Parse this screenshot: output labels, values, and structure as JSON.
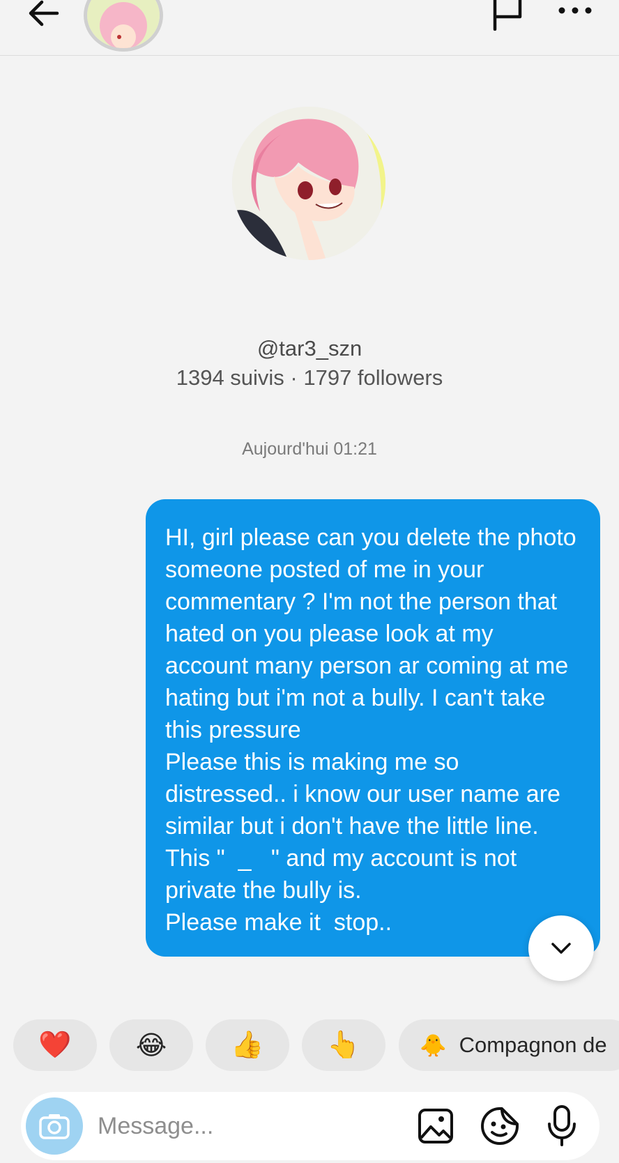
{
  "header": {
    "icons": [
      "back-arrow-icon",
      "flag-icon",
      "more-dots-icon"
    ]
  },
  "profile": {
    "username": "@tar3_szn",
    "stats": "1394 suivis · 1797 followers"
  },
  "conversation": {
    "timestamp": "Aujourd'hui 01:21",
    "message_text": "HI, girl please can you delete the photo someone posted of me in your commentary ? I'm not the person that hated on you please look at my account many person ar coming at me hating but i'm not a bully. I can't take this pressure\nPlease this is making me so distressed.. i know our user name are similar but i don't have the little line. This \"  _   \" and my account is not private the bully is.\nPlease make it  stop..",
    "bubble_color": "#0f96e8"
  },
  "reactions": [
    {
      "emoji": "❤️",
      "name": "heart"
    },
    {
      "emoji": "😂",
      "name": "tears-of-joy"
    },
    {
      "emoji": "👍",
      "name": "thumbs-up"
    },
    {
      "emoji": "👆",
      "name": "pointing-up"
    }
  ],
  "suggestion_chip": {
    "emoji": "🐥",
    "label": "Compagnon de"
  },
  "composer": {
    "placeholder": "Message...",
    "icons": [
      "camera-icon",
      "gallery-icon",
      "sticker-icon",
      "microphone-icon"
    ]
  }
}
